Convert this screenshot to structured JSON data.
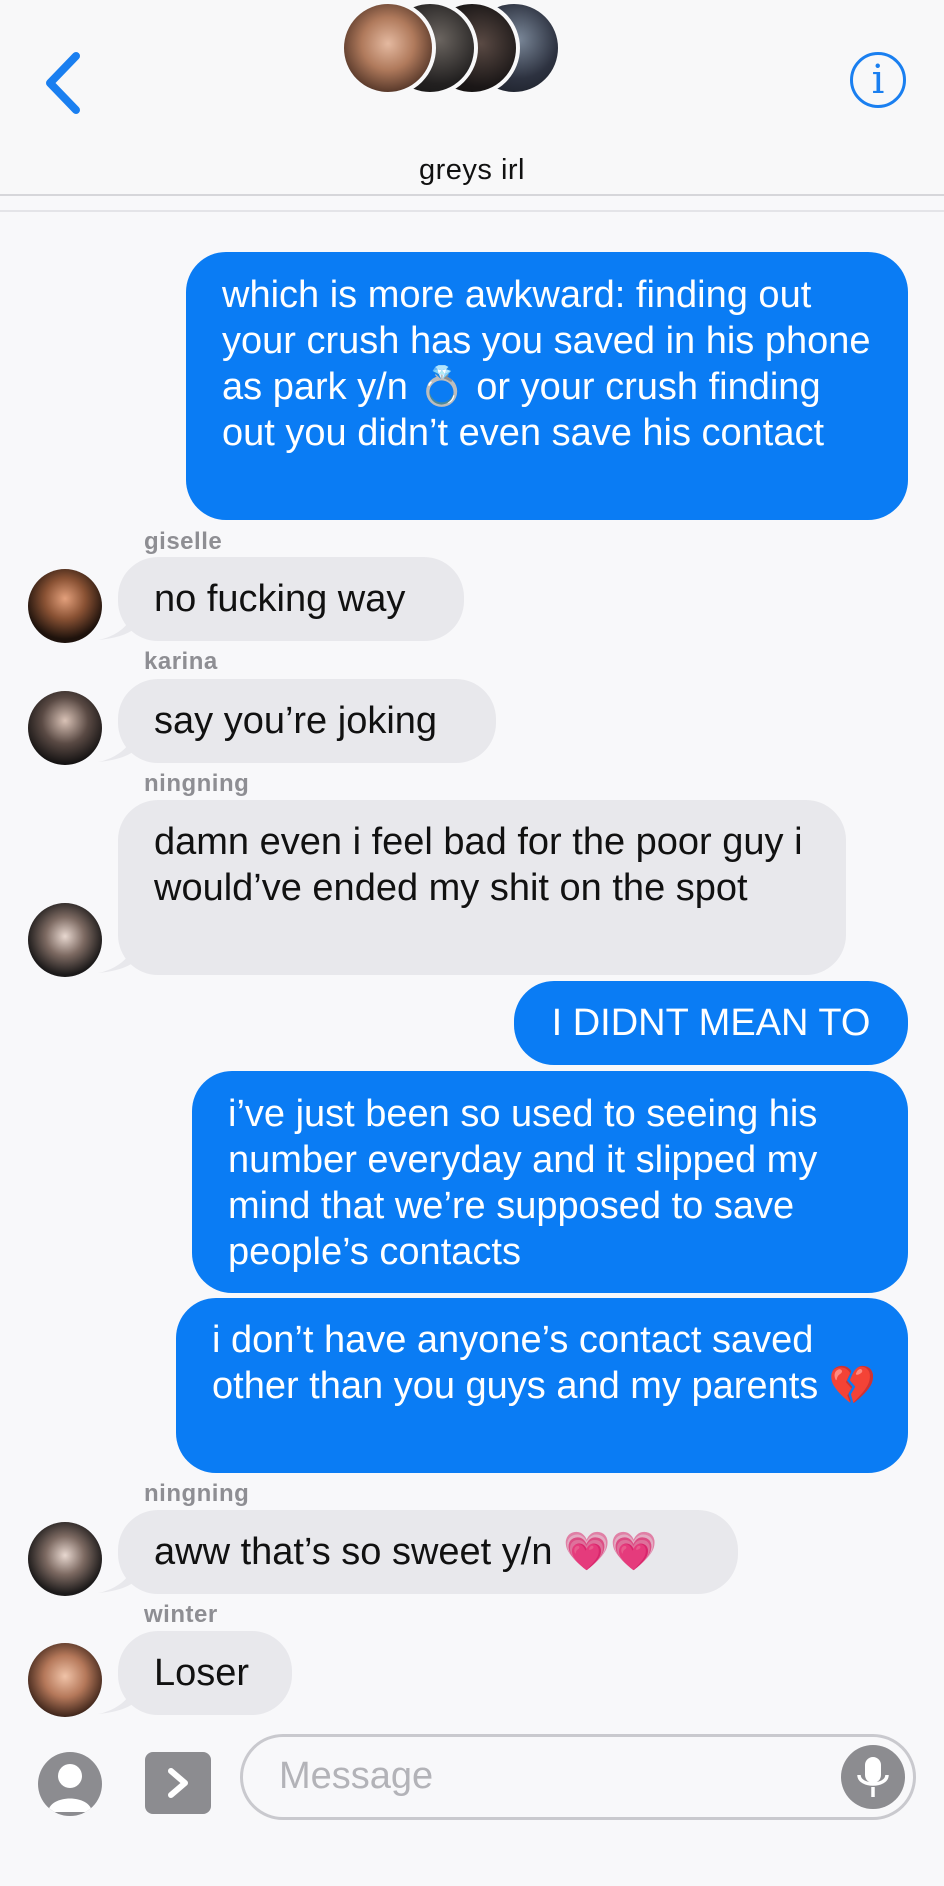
{
  "header": {
    "title": "greys irl",
    "back_icon": "chevron-left-icon",
    "info_icon": "info-icon",
    "info_glyph": "i",
    "accent": "#0a7cf4"
  },
  "messages": [
    {
      "type": "out",
      "text": "which is more awkward: finding out your crush has you saved in his phone as park y/n 💍 or your crush finding out you didn’t even save his contact"
    },
    {
      "type": "in",
      "sender": "giselle",
      "text": "no fucking way"
    },
    {
      "type": "in",
      "sender": "karina",
      "text": "say you’re joking"
    },
    {
      "type": "in",
      "sender": "ningning",
      "text": "damn even i feel bad for the poor guy i would’ve ended my shit on the spot"
    },
    {
      "type": "out",
      "text": "I DIDNT MEAN TO"
    },
    {
      "type": "out",
      "text": "i’ve just been so used to seeing his number everyday and it slipped my mind that we’re supposed to save people’s contacts"
    },
    {
      "type": "out",
      "text": "i don’t have anyone’s contact saved other than you guys and my parents 💔"
    },
    {
      "type": "in",
      "sender": "ningning",
      "text": "aww that’s so sweet y/n 💗💗"
    },
    {
      "type": "in",
      "sender": "winter",
      "text": "Loser"
    }
  ],
  "composer": {
    "placeholder": "Message",
    "person_icon": "person-icon",
    "apps_icon": "chevron-right-icon",
    "mic_icon": "microphone-icon"
  },
  "colors": {
    "outgoing_bubble": "#0a7cf4",
    "incoming_bubble": "#e8e8ec",
    "sender_name": "#8e8e93"
  }
}
